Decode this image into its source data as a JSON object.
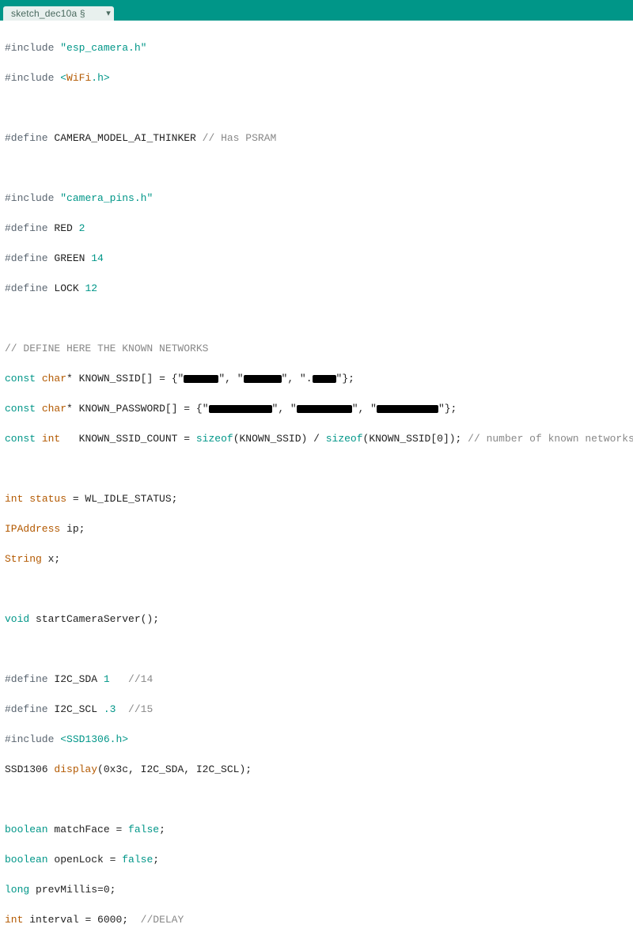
{
  "tab": {
    "label": "sketch_dec10a §"
  },
  "code": {
    "l1_inc": "#include",
    "l1_str": "\"esp_camera.h\"",
    "l2_inc": "#include",
    "l2_a": "<",
    "l2_wifi": "WiFi",
    "l2_b": ".h>",
    "l4_def": "#define",
    "l4_id": "CAMERA_MODEL_AI_THINKER",
    "l4_cmt": "// Has PSRAM",
    "l6_inc": "#include",
    "l6_str": "\"camera_pins.h\"",
    "l7_def": "#define",
    "l7_id": "RED",
    "l7_val": "2",
    "l8_def": "#define",
    "l8_id": "GREEN",
    "l8_val": "14",
    "l9_def": "#define",
    "l9_id": "LOCK",
    "l9_val": "12",
    "l11_cmt": "// DEFINE HERE THE KNOWN NETWORKS",
    "l12_kw": "const",
    "l12_type": "char",
    "l12_star": "*",
    "l12_id": "KNOWN_SSID[]",
    "l12_eq": " = {\"",
    "l12_mid1": "\", \"",
    "l12_mid2": "\", \".",
    "l12_end": "\"};",
    "l13_kw": "const",
    "l13_type": "char",
    "l13_star": "*",
    "l13_id": "KNOWN_PASSWORD[]",
    "l13_eq": " = {\"",
    "l13_mid1": "\", \"",
    "l13_mid2": "\", \"",
    "l13_end": "\"};",
    "l14_kw": "const",
    "l14_type": "int",
    "l14_id": "KNOWN_SSID_COUNT",
    "l14_eq": " = ",
    "l14_sz1": "sizeof",
    "l14_arg1": "(KNOWN_SSID) / ",
    "l14_sz2": "sizeof",
    "l14_arg2": "(KNOWN_SSID[0]);",
    "l14_cmt": " // number of known networks",
    "l16_type": "int",
    "l16_fn": "status",
    "l16_rest": " = WL_IDLE_STATUS;",
    "l17_ip": "IPAddress",
    "l17_rest": " ip;",
    "l18_str": "String",
    "l18_rest": " x;",
    "l20_void": "void",
    "l20_fn": "startCameraServer",
    "l20_rest": "();",
    "l22_def": "#define",
    "l22_id": "I2C_SDA",
    "l22_val": "1",
    "l22_cmt": "   //14",
    "l23_def": "#define",
    "l23_id": "I2C_SCL",
    "l23_val": ".3",
    "l23_cmt": "  //15",
    "l24_inc": "#include",
    "l24_str": "<SSD1306.h>",
    "l25_cls": "SSD1306 ",
    "l25_fn": "display",
    "l25_args": "(0x3c, I2C_SDA, I2C_SCL);",
    "l27_kw": "boolean",
    "l27_id": "matchFace",
    "l27_rest": " = ",
    "l27_val": "false",
    "l27_end": ";",
    "l28_kw": "boolean",
    "l28_id": "openLock",
    "l28_rest": " = ",
    "l28_val": "false",
    "l28_end": ";",
    "l29_kw": "long",
    "l29_id": "prevMillis",
    "l29_rest": "=0;",
    "l30_type": "int",
    "l30_id": "interval",
    "l30_rest": " = 6000;",
    "l30_cmt": "  //DELAY"
  }
}
